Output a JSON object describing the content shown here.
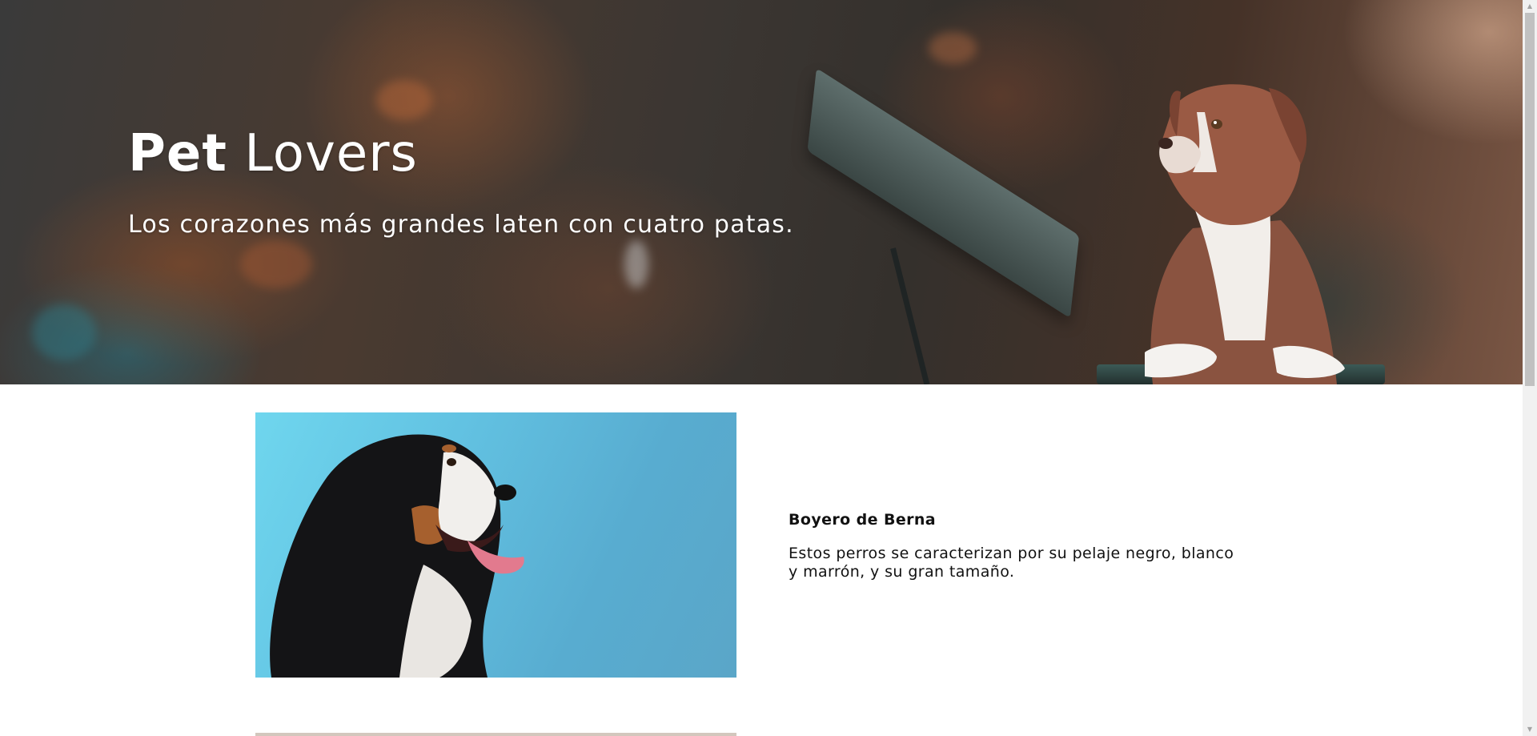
{
  "hero": {
    "title_bold": "Pet",
    "title_rest": " Lovers",
    "subtitle": "Los corazones más grandes laten con cuatro patas."
  },
  "cards": [
    {
      "title": "Boyero de Berna",
      "description": "Estos perros se caracterizan por su pelaje negro, blanco y marrón, y su gran tamaño."
    }
  ],
  "icons": {
    "scroll_up": "scroll-up-arrow-icon",
    "scroll_down": "scroll-down-arrow-icon"
  },
  "colors": {
    "hero_text": "#ffffff",
    "body_text": "#111111",
    "card_image_bg": "#62c2e2"
  }
}
